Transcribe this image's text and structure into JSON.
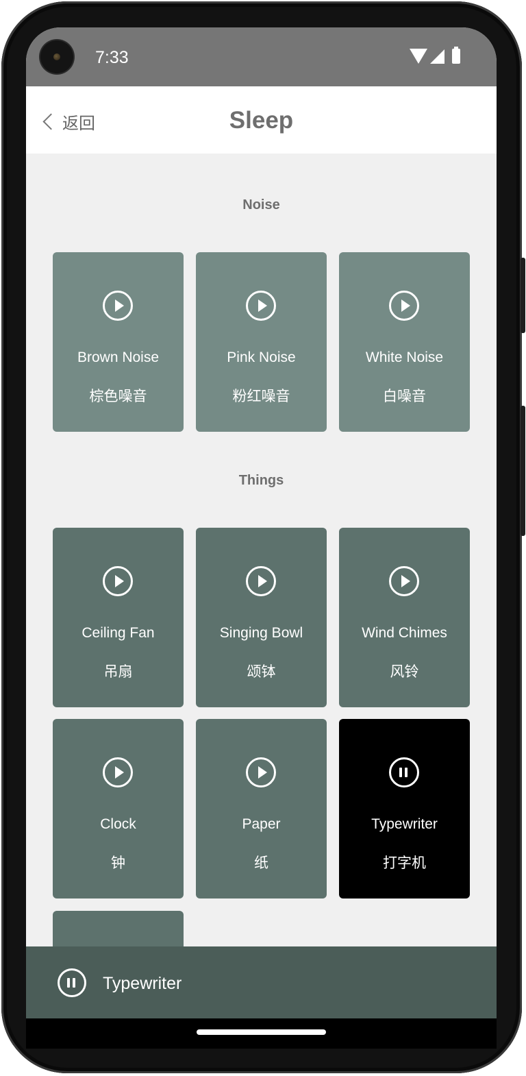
{
  "status_bar": {
    "time": "7:33",
    "icons": [
      "wifi-icon",
      "signal-icon",
      "battery-icon"
    ]
  },
  "nav": {
    "back_label": "返回",
    "title": "Sleep"
  },
  "sections": [
    {
      "title": "Noise",
      "tiles": [
        {
          "en": "Brown Noise",
          "zh": "棕色噪音",
          "state": "play"
        },
        {
          "en": "Pink Noise",
          "zh": "粉红噪音",
          "state": "play"
        },
        {
          "en": "White Noise",
          "zh": "白噪音",
          "state": "play"
        }
      ]
    },
    {
      "title": "Things",
      "tiles": [
        {
          "en": "Ceiling Fan",
          "zh": "吊扇",
          "state": "play"
        },
        {
          "en": "Singing Bowl",
          "zh": "颂钵",
          "state": "play"
        },
        {
          "en": "Wind Chimes",
          "zh": "风铃",
          "state": "play"
        },
        {
          "en": "Clock",
          "zh": "钟",
          "state": "play"
        },
        {
          "en": "Paper",
          "zh": "纸",
          "state": "play"
        },
        {
          "en": "Typewriter",
          "zh": "打字机",
          "state": "pause"
        },
        {
          "en": "",
          "zh": "",
          "state": "play"
        }
      ]
    }
  ],
  "player": {
    "now_playing": "Typewriter",
    "state": "pause"
  },
  "colors": {
    "status_bar": "#767676",
    "noise_tile": "#758b86",
    "things_tile": "#5d726d",
    "active_tile": "#000000",
    "player_bar": "#4b5d58",
    "background": "#f0f0f0"
  }
}
